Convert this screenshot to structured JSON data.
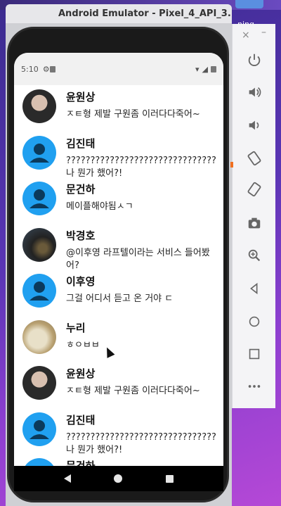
{
  "window": {
    "title": "Android Emulator - Pixel_4_API_3..."
  },
  "desktop": {
    "snippet": "ning"
  },
  "statusbar": {
    "time": "5:10"
  },
  "chats": [
    {
      "name": "윤원상",
      "message": "ㅈㅌ형 제발 구원좀 이러다다죽어~",
      "avatar": "photo1"
    },
    {
      "name": "김진태",
      "message": "???????????????????????????????나 뭔가 했어?!",
      "avatar": "default"
    },
    {
      "name": "문건하",
      "message": "메이플해야됨ㅅㄱ",
      "avatar": "default"
    },
    {
      "name": "박경호",
      "message": "@이후영 라프텔이라는 서비스 들어봤어?",
      "avatar": "photo2"
    },
    {
      "name": "이후영",
      "message": "그걸 어디서 듣고 온 거야 ㄷ",
      "avatar": "default"
    },
    {
      "name": "누리",
      "message": "ㅎㅇㅂㅂ",
      "avatar": "photo3"
    },
    {
      "name": "윤원상",
      "message": "ㅈㅌ형 제발 구원좀 이러다다죽어~",
      "avatar": "photo1"
    },
    {
      "name": "김진태",
      "message": "???????????????????????????????나 뭔가 했어?!",
      "avatar": "default"
    },
    {
      "name": "문건하",
      "message": "",
      "avatar": "default"
    }
  ],
  "side_controls": [
    "power-icon",
    "volume-up-icon",
    "volume-down-icon",
    "rotate-left-icon",
    "rotate-right-icon",
    "camera-icon",
    "zoom-icon",
    "back-icon",
    "home-icon",
    "overview-icon",
    "more-icon"
  ],
  "colors": {
    "default_avatar": "#20a0f0"
  }
}
